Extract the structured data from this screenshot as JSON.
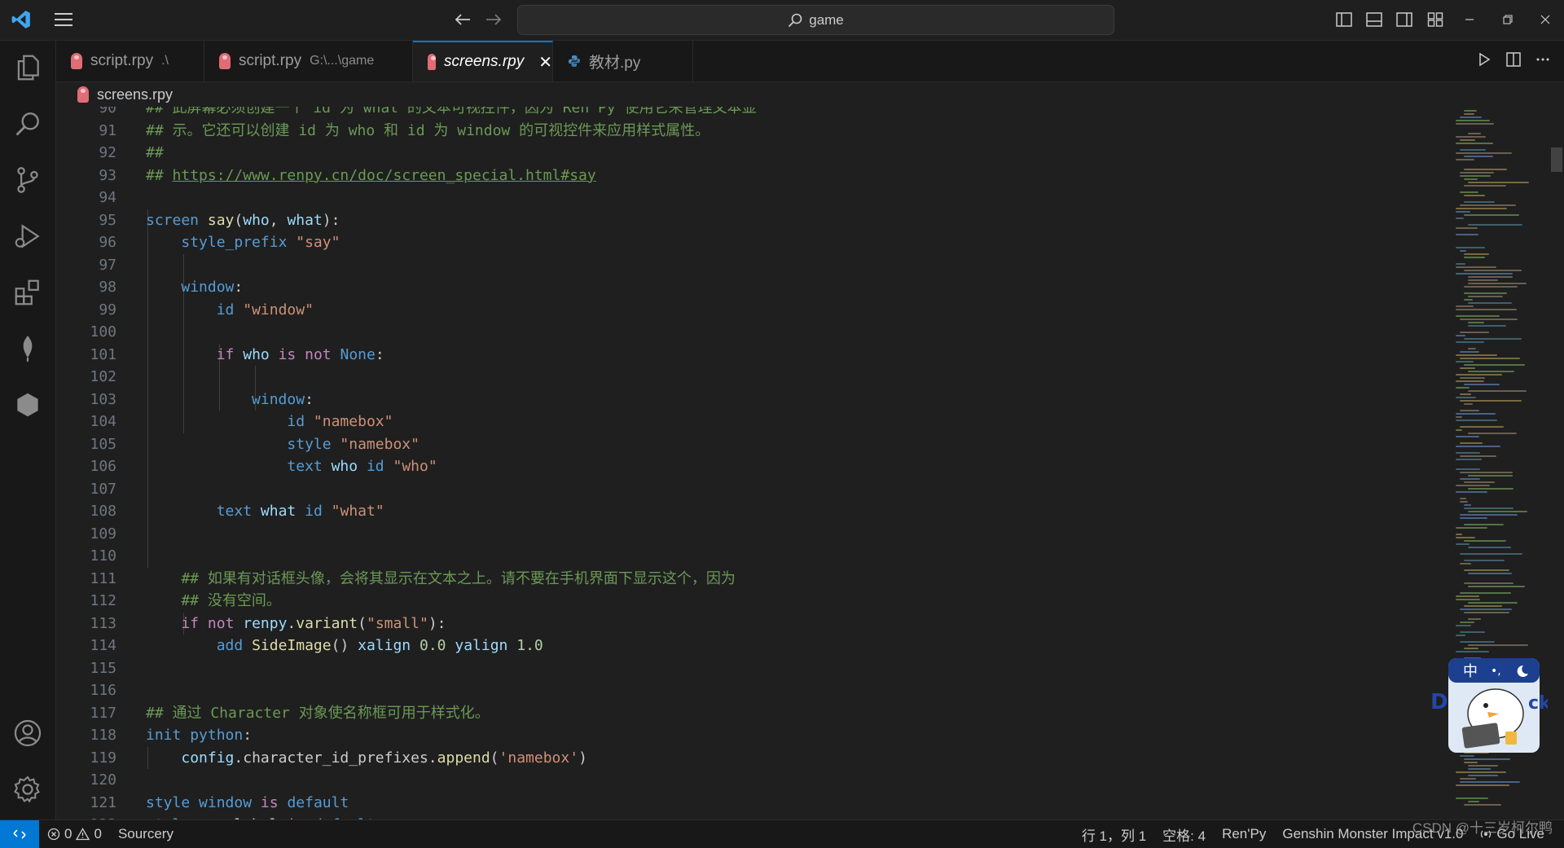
{
  "titlebar": {
    "search_text": "game"
  },
  "tabs": [
    {
      "label": "script.rpy",
      "desc": ".\\",
      "icon": "renpy-file-icon",
      "active": false
    },
    {
      "label": "script.rpy",
      "desc": "G:\\...\\game",
      "icon": "renpy-file-icon",
      "active": false
    },
    {
      "label": "screens.rpy",
      "desc": "",
      "icon": "renpy-file-icon",
      "active": true
    },
    {
      "label": "教材.py",
      "desc": "",
      "icon": "python-file-icon",
      "active": false
    }
  ],
  "breadcrumb": {
    "file": "screens.rpy"
  },
  "editor": {
    "lines": [
      {
        "num": "90",
        "text": "## 此屏幕必须创建一个 id 为 what 的文本可视控件，因为 Ren'Py 使用它来管理文本显"
      },
      {
        "num": "91",
        "text": "## 示。它还可以创建 id 为 who 和 id 为 window 的可视控件来应用样式属性。"
      },
      {
        "num": "92",
        "text": "##"
      },
      {
        "num": "93",
        "text": "## https://www.renpy.cn/doc/screen_special.html#say"
      },
      {
        "num": "94",
        "text": ""
      },
      {
        "num": "95",
        "text": "screen say(who, what):"
      },
      {
        "num": "96",
        "text": "    style_prefix \"say\""
      },
      {
        "num": "97",
        "text": ""
      },
      {
        "num": "98",
        "text": "    window:"
      },
      {
        "num": "99",
        "text": "        id \"window\""
      },
      {
        "num": "100",
        "text": ""
      },
      {
        "num": "101",
        "text": "        if who is not None:"
      },
      {
        "num": "102",
        "text": ""
      },
      {
        "num": "103",
        "text": "            window:"
      },
      {
        "num": "104",
        "text": "                id \"namebox\""
      },
      {
        "num": "105",
        "text": "                style \"namebox\""
      },
      {
        "num": "106",
        "text": "                text who id \"who\""
      },
      {
        "num": "107",
        "text": ""
      },
      {
        "num": "108",
        "text": "        text what id \"what\""
      },
      {
        "num": "109",
        "text": ""
      },
      {
        "num": "110",
        "text": ""
      },
      {
        "num": "111",
        "text": "    ## 如果有对话框头像，会将其显示在文本之上。请不要在手机界面下显示这个，因为"
      },
      {
        "num": "112",
        "text": "    ## 没有空间。"
      },
      {
        "num": "113",
        "text": "    if not renpy.variant(\"small\"):"
      },
      {
        "num": "114",
        "text": "        add SideImage() xalign 0.0 yalign 1.0"
      },
      {
        "num": "115",
        "text": ""
      },
      {
        "num": "116",
        "text": ""
      },
      {
        "num": "117",
        "text": "## 通过 Character 对象使名称框可用于样式化。"
      },
      {
        "num": "118",
        "text": "init python:"
      },
      {
        "num": "119",
        "text": "    config.character_id_prefixes.append('namebox')"
      },
      {
        "num": "120",
        "text": ""
      },
      {
        "num": "121",
        "text": "style window is default"
      },
      {
        "num": "122",
        "text": "style say_label is default"
      }
    ]
  },
  "statusbar": {
    "errors": "0",
    "warnings": "0",
    "sourcery": "Sourcery",
    "position": "行 1，列 1",
    "spaces": "空格: 4",
    "language": "Ren'Py",
    "extension": "Genshin Monster Impact v1.0",
    "golive": "Go Live"
  },
  "watermark": "CSDN @十三岁柯尔鸭",
  "colors": {
    "accent": "#0078d4",
    "comment": "#6a9955",
    "keyword": "#569cd6",
    "string": "#ce9178"
  }
}
